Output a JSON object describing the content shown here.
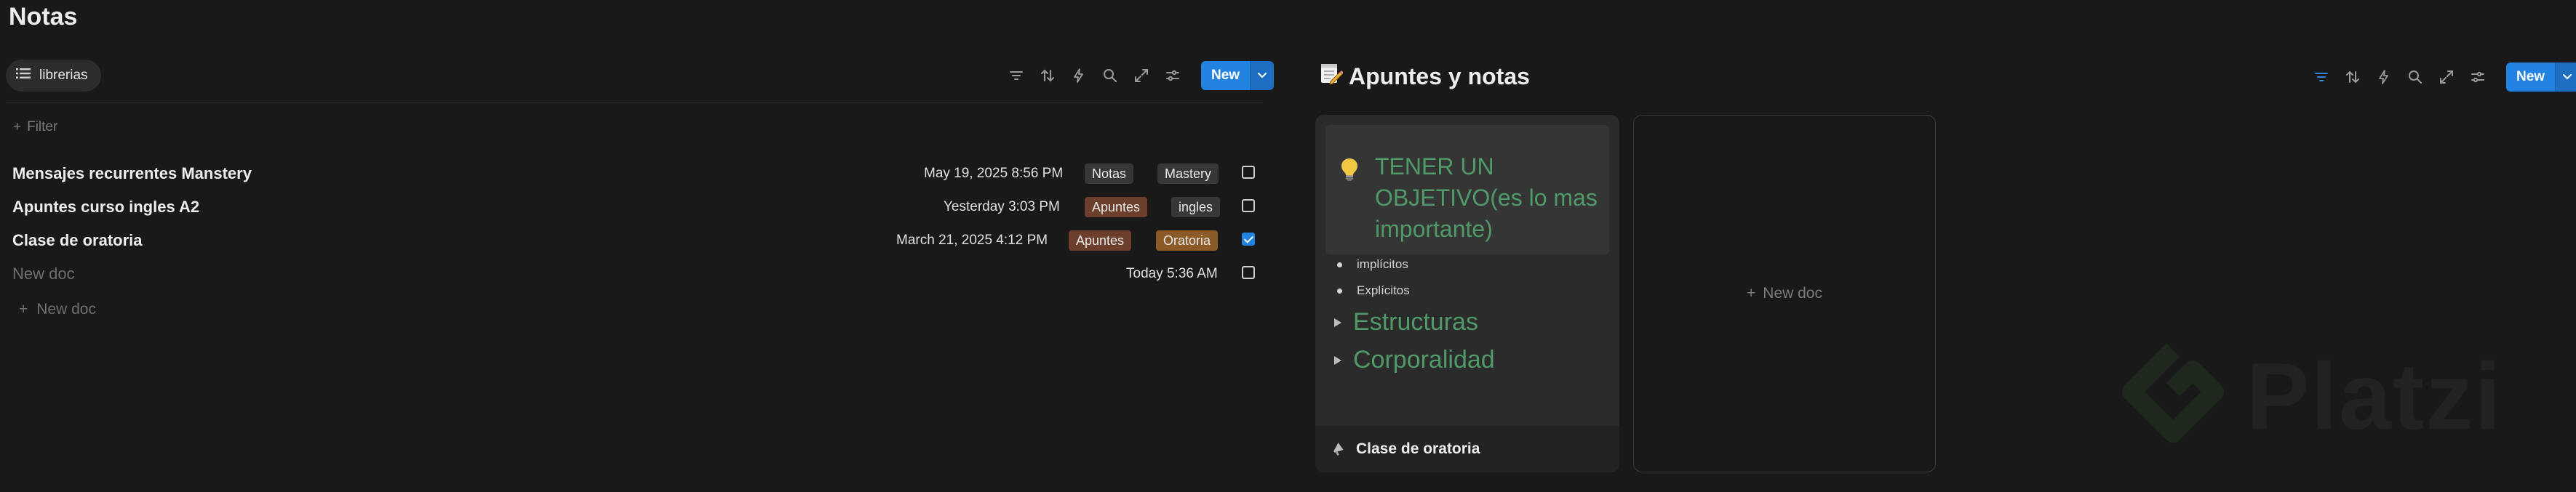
{
  "page_title": "Notas",
  "left": {
    "view_tab": "librerias",
    "new_label": "New",
    "filter_label": "Filter",
    "rows": [
      {
        "name": "Mensajes recurrentes Manstery",
        "date": "May 19, 2025 8:56 PM",
        "tags": [
          "Notas",
          "Mastery"
        ],
        "checked": false
      },
      {
        "name": "Apuntes curso ingles A2",
        "date": "Yesterday 3:03 PM",
        "tags": [
          "Apuntes",
          "ingles"
        ],
        "checked": false
      },
      {
        "name": "Clase de oratoria",
        "date": "March 21, 2025 4:12 PM",
        "tags": [
          "Apuntes",
          "Oratoria"
        ],
        "checked": true
      },
      {
        "name": "New doc",
        "date": "Today 5:36 AM",
        "tags": [],
        "checked": false
      }
    ],
    "new_doc_label": "New doc"
  },
  "right": {
    "title": "Apuntes y notas",
    "new_label": "New",
    "card": {
      "callout": "TENER UN OBJETIVO(es lo mas importante)",
      "bullets": [
        "implícitos",
        "Explícitos"
      ],
      "toggles": [
        "Estructuras",
        "Corporalidad"
      ],
      "footer": "Clase de oratoria"
    },
    "new_doc_label": "New doc"
  },
  "watermark": "Platzi",
  "colors": {
    "background": "#191919",
    "accent_blue": "#2383e2",
    "green_text": "#4f9a68",
    "tag_gray": "#373737",
    "tag_brown": "#6b3f2b",
    "tag_orange": "#8c5a27"
  }
}
